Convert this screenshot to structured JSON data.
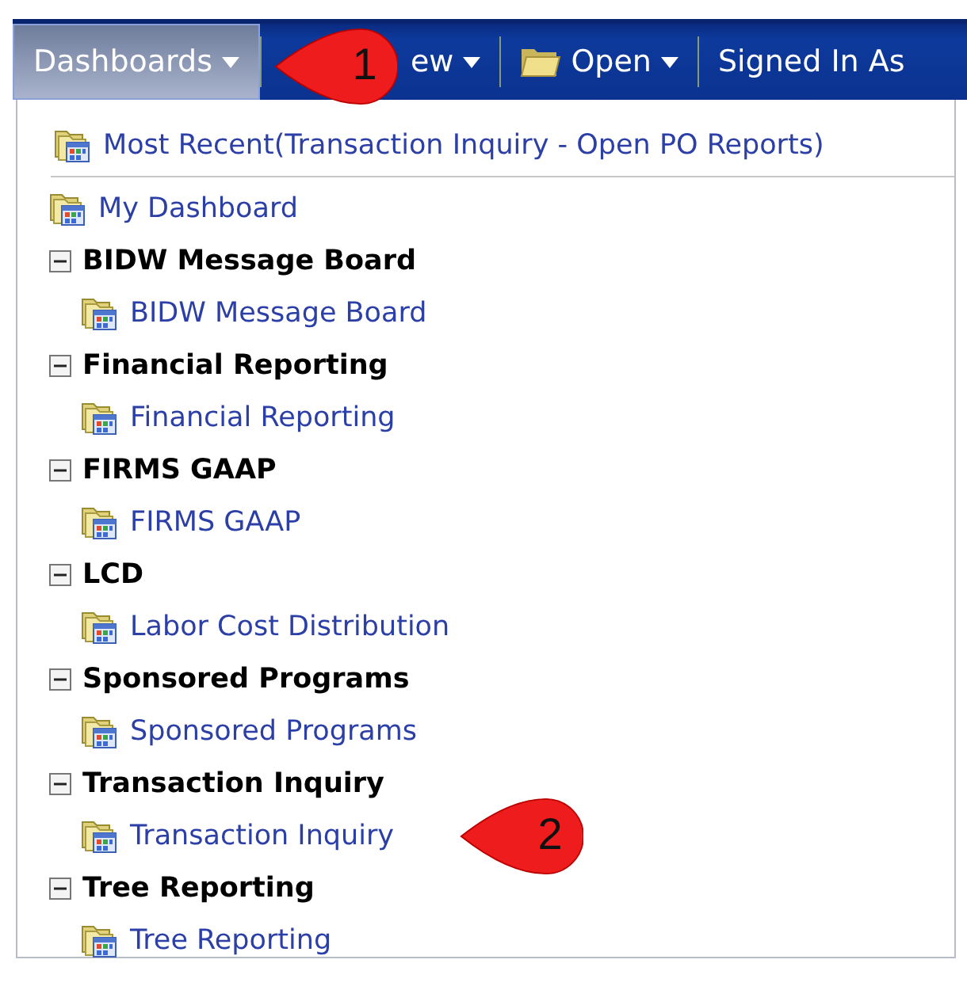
{
  "toolbar": [
    {
      "kind": "menu",
      "label": "Dashboards",
      "selected": true
    },
    {
      "kind": "menu",
      "label": "ew",
      "selected": false
    },
    {
      "kind": "folder-menu",
      "label": "Open",
      "selected": false
    },
    {
      "kind": "text",
      "label": "Signed In As"
    }
  ],
  "menu": {
    "recent": "Most Recent(Transaction Inquiry - Open PO Reports)",
    "items": [
      {
        "label": "My Dashboard"
      }
    ],
    "groups": [
      {
        "label": "BIDW Message Board",
        "expanded": true,
        "children": [
          {
            "label": "BIDW Message Board"
          }
        ]
      },
      {
        "label": "Financial Reporting",
        "expanded": true,
        "children": [
          {
            "label": "Financial Reporting"
          }
        ]
      },
      {
        "label": "FIRMS GAAP",
        "expanded": true,
        "children": [
          {
            "label": "FIRMS GAAP"
          }
        ]
      },
      {
        "label": "LCD",
        "expanded": true,
        "children": [
          {
            "label": "Labor Cost Distribution"
          }
        ]
      },
      {
        "label": "Sponsored Programs",
        "expanded": true,
        "children": [
          {
            "label": "Sponsored Programs"
          }
        ]
      },
      {
        "label": "Transaction Inquiry",
        "expanded": true,
        "children": [
          {
            "label": "Transaction Inquiry"
          }
        ]
      },
      {
        "label": "Tree Reporting",
        "expanded": true,
        "children": [
          {
            "label": "Tree Reporting"
          }
        ]
      }
    ]
  },
  "callouts": [
    {
      "number": "1"
    },
    {
      "number": "2"
    }
  ]
}
